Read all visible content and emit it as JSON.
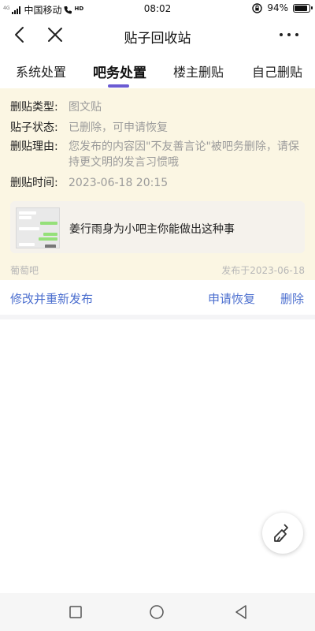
{
  "status_bar": {
    "signal_mini": "4G",
    "carrier": "中国移动",
    "hd": "HD",
    "time": "08:02",
    "battery": "94%",
    "battery_level": 0.94
  },
  "nav": {
    "title": "贴子回收站"
  },
  "tabs": [
    {
      "label": "系统处置",
      "active": false
    },
    {
      "label": "吧务处置",
      "active": true
    },
    {
      "label": "楼主删贴",
      "active": false
    },
    {
      "label": "自己删贴",
      "active": false
    }
  ],
  "record": {
    "type_label": "删贴类型:",
    "type_value": "图文贴",
    "status_label": "贴子状态:",
    "status_value": "已删除，可申请恢复",
    "reason_label": "删贴理由:",
    "reason_value": "您发布的内容因\"不友善言论\"被吧务删除，请保持更文明的发言习惯哦",
    "time_label": "删贴时间:",
    "time_value": "2023-06-18 20:15",
    "post_text": "姜行雨身为小吧主你能做出这种事",
    "bar_name": "葡萄吧",
    "published": "发布于2023-06-18"
  },
  "actions": {
    "republish": "修改并重新发布",
    "restore": "申请恢复",
    "delete": "删除"
  },
  "colors": {
    "accent": "#6b5bd2",
    "link": "#4c6fcf",
    "card_bg": "#fbf6e3",
    "muted": "#9b9b9b"
  },
  "icons": {
    "back": "chevron-left",
    "close": "close-x",
    "more": "more-dots",
    "fab": "broom"
  }
}
